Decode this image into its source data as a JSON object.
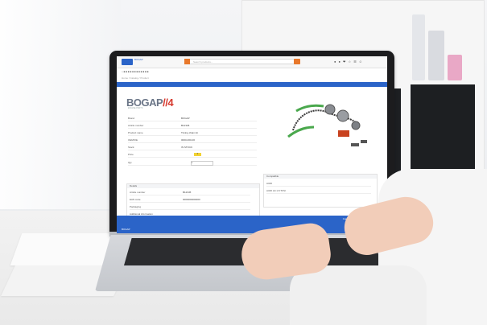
{
  "screen": {
    "brand": "BOGAP",
    "brand_mark": "//4",
    "brand_sub": "ENGINE PARTS",
    "search_placeholder": "Search products...",
    "topbar_icons": "● ● ❤ ☆ ☰ ☺",
    "menu": "⌂ ■ ■ ■ ■ ■ ■ ■ ■ ■ ■ ■ ■",
    "breadcrumb": "Home / Catalog / Product",
    "bluebar_title": "Detail",
    "rows": [
      {
        "label": "Brand",
        "value": "BOGAP"
      },
      {
        "label": "Article number",
        "value": "B12345"
      },
      {
        "label": "Product name",
        "value": "Timing chain kit"
      },
      {
        "label": "OEM/OE",
        "value": "0000-000-00"
      },
      {
        "label": "Stock",
        "value": "IN STOCK"
      },
      {
        "label": "Price",
        "value": ""
      },
      {
        "label": "Qty",
        "value": "1"
      }
    ],
    "badge": "5",
    "panel_left_title": "Details",
    "panel_right_title": "Compatible",
    "panel_left_rows": [
      {
        "label": "Article number",
        "value": "B12345"
      },
      {
        "label": "EAN code",
        "value": "0000000000000"
      },
      {
        "label": "Packaging",
        "value": ""
      },
      {
        "label": "Additional information",
        "value": ""
      }
    ],
    "panel_right_rows": [
      "AUDI",
      "AUDI A4 1.8 TFSI"
    ],
    "footer_text": "Contact • Terms • Privacy • Cookies",
    "footer_left": "BOGAP"
  },
  "colors": {
    "accent_blue": "#2b64c8",
    "orange": "#e8782b",
    "badge_yellow": "#f2d234",
    "brand_red": "#d63a2f"
  }
}
